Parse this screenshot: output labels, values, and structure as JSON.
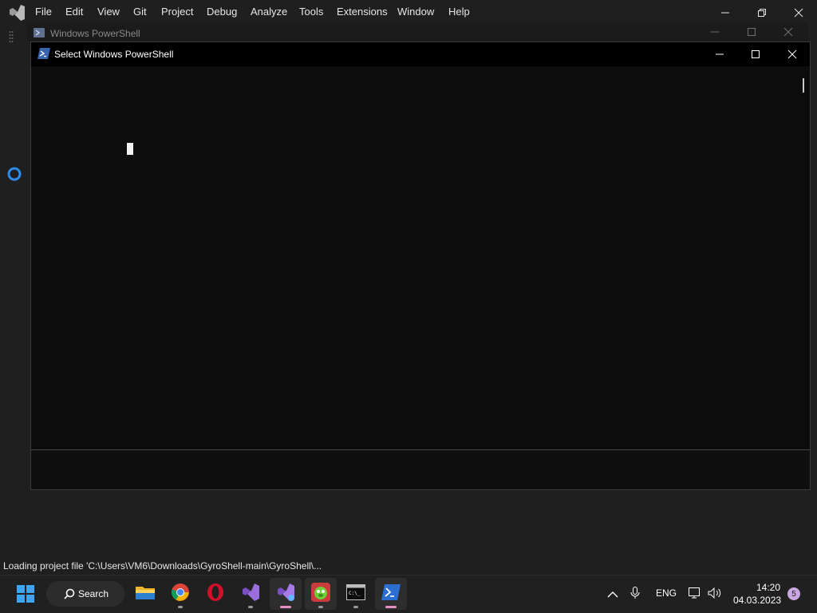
{
  "vs_menu": {
    "items": [
      "File",
      "Edit",
      "View",
      "Git",
      "Project",
      "Debug",
      "Analyze",
      "Tools",
      "Extensions",
      "Window",
      "Help"
    ]
  },
  "background_window": {
    "title": "Windows PowerShell"
  },
  "front_window": {
    "title": "Select Windows PowerShell"
  },
  "status_bar": {
    "text": "Loading project file 'C:\\Users\\VM6\\Downloads\\GyroShell-main\\GyroShell\\..."
  },
  "taskbar": {
    "search_label": "Search",
    "apps": [
      {
        "name": "file-explorer-icon",
        "label": "File Explorer"
      },
      {
        "name": "chrome-icon",
        "label": "Google Chrome"
      },
      {
        "name": "opera-icon",
        "label": "Opera"
      },
      {
        "name": "visual-studio-icon",
        "label": "Visual Studio"
      },
      {
        "name": "visual-studio-preview-icon",
        "label": "Visual Studio (running)"
      },
      {
        "name": "game-app-icon",
        "label": "App"
      },
      {
        "name": "command-prompt-icon",
        "label": "Command Prompt"
      },
      {
        "name": "powershell-icon",
        "label": "Windows PowerShell"
      }
    ],
    "language": "ENG",
    "time": "14:20",
    "date": "04.03.2023",
    "notification_count": "5"
  },
  "colors": {
    "accent": "#0078d4",
    "vs_purple": "#8661c5",
    "background": "#1f1f1f",
    "console": "#0c0c0c"
  }
}
